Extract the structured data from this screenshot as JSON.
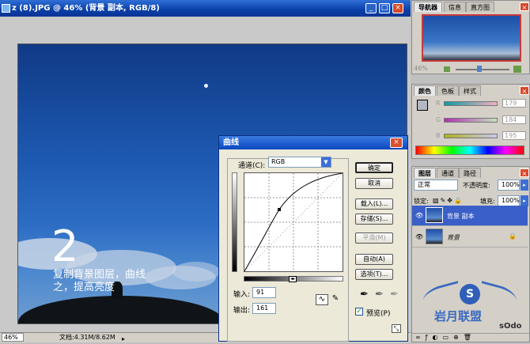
{
  "document": {
    "title": "z (8).JPG @ 46% (背景 副本, RGB/8)",
    "zoom": "46%",
    "doc_info": "文档:4.31M/8.62M",
    "overlay_number": "2",
    "caption_line1": "复制背景图层，曲线",
    "caption_line2": "之，提高亮度"
  },
  "title_buttons": {
    "minimize": "_",
    "maximize": "□",
    "close": "×"
  },
  "curves": {
    "title": "曲线",
    "channel_label": "通道(C):",
    "channel_value": "RGB",
    "buttons": {
      "ok": "确定",
      "cancel": "取消",
      "load": "载入(L)...",
      "save": "存储(S)...",
      "smooth": "平滑(M)",
      "auto": "自动(A)",
      "options": "选项(T)..."
    },
    "input_label": "输入:",
    "input_value": "91",
    "output_label": "输出:",
    "output_value": "161",
    "preview_label": "预览(P)",
    "preview_checked": true,
    "curve_point": {
      "input": 91,
      "output": 161
    }
  },
  "navigator_panel": {
    "tabs": [
      "导航器",
      "信息",
      "直方图"
    ],
    "active_tab": "导航器",
    "zoom": "46%"
  },
  "color_panel": {
    "tabs": [
      "颜色",
      "色板",
      "样式"
    ],
    "active_tab": "颜色",
    "channels": [
      {
        "label": "R",
        "value": "179"
      },
      {
        "label": "G",
        "value": "184"
      },
      {
        "label": "B",
        "value": "195"
      }
    ]
  },
  "layers_panel": {
    "tabs": [
      "图层",
      "通道",
      "路径"
    ],
    "active_tab": "图层",
    "blend_mode": "正常",
    "opacity_label": "不透明度:",
    "opacity": "100%",
    "lock_label": "锁定:",
    "fill_label": "填充:",
    "fill": "100%",
    "layers": [
      {
        "name": "背景 副本",
        "selected": true
      },
      {
        "name": "背景",
        "selected": false
      }
    ]
  },
  "watermark": {
    "text": "岩月联盟",
    "sub": "sOdo"
  },
  "colors": {
    "title_blue": "#0a3fa8",
    "selected_layer": "#3a5fc8",
    "dialog_bg": "#ece9d8"
  }
}
